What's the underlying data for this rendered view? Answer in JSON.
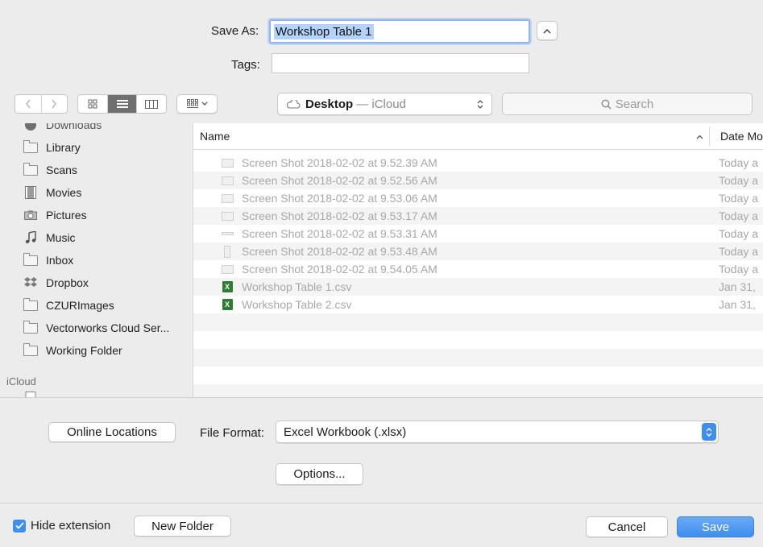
{
  "save_as": {
    "label": "Save As:",
    "value": "Workshop Table 1"
  },
  "tags": {
    "label": "Tags:",
    "value": ""
  },
  "toolbar": {
    "location_label": "Desktop",
    "location_sub": "— iCloud",
    "search_placeholder": "Search"
  },
  "sidebar": {
    "partial_top": "Downloads",
    "items": [
      {
        "label": "Library",
        "icon": "folder-icon"
      },
      {
        "label": "Scans",
        "icon": "folder-icon"
      },
      {
        "label": "Movies",
        "icon": "film-icon"
      },
      {
        "label": "Pictures",
        "icon": "camera-icon"
      },
      {
        "label": "Music",
        "icon": "music-note-icon"
      },
      {
        "label": "Inbox",
        "icon": "folder-icon"
      },
      {
        "label": "Dropbox",
        "icon": "dropbox-icon"
      },
      {
        "label": "CZURImages",
        "icon": "folder-icon"
      },
      {
        "label": "Vectorworks Cloud Ser...",
        "icon": "folder-icon"
      },
      {
        "label": "Working Folder",
        "icon": "folder-icon"
      }
    ],
    "section_icloud": "iCloud"
  },
  "file_list": {
    "col_name": "Name",
    "col_date": "Date Mo",
    "rows": [
      {
        "name": "Screen Shot 2018-02-02 at 9.52.39 AM",
        "date": "Today a",
        "icon": "image-file-icon"
      },
      {
        "name": "Screen Shot 2018-02-02 at 9.52.56 AM",
        "date": "Today a",
        "icon": "image-file-icon"
      },
      {
        "name": "Screen Shot 2018-02-02 at 9.53.06 AM",
        "date": "Today a",
        "icon": "image-file-icon"
      },
      {
        "name": "Screen Shot 2018-02-02 at 9.53.17 AM",
        "date": "Today a",
        "icon": "image-file-icon"
      },
      {
        "name": "Screen Shot 2018-02-02 at 9.53.31 AM",
        "date": "Today a",
        "icon": "image-file-icon"
      },
      {
        "name": "Screen Shot 2018-02-02 at 9.53.48 AM",
        "date": "Today a",
        "icon": "image-file-icon"
      },
      {
        "name": "Screen Shot 2018-02-02 at 9.54.05 AM",
        "date": "Today a",
        "icon": "image-file-icon"
      },
      {
        "name": "Workshop Table 1.csv",
        "date": "Jan 31,",
        "icon": "excel-file-icon"
      },
      {
        "name": "Workshop Table 2.csv",
        "date": "Jan 31,",
        "icon": "excel-file-icon"
      }
    ]
  },
  "bottom": {
    "online_locations": "Online Locations",
    "file_format_label": "File Format:",
    "file_format_value": "Excel Workbook (.xlsx)",
    "options": "Options...",
    "hide_extension": "Hide extension",
    "hide_extension_checked": true,
    "new_folder": "New Folder",
    "cancel": "Cancel",
    "save": "Save"
  },
  "colors": {
    "accent": "#3d8ef0",
    "selection": "#b4d3fb"
  }
}
